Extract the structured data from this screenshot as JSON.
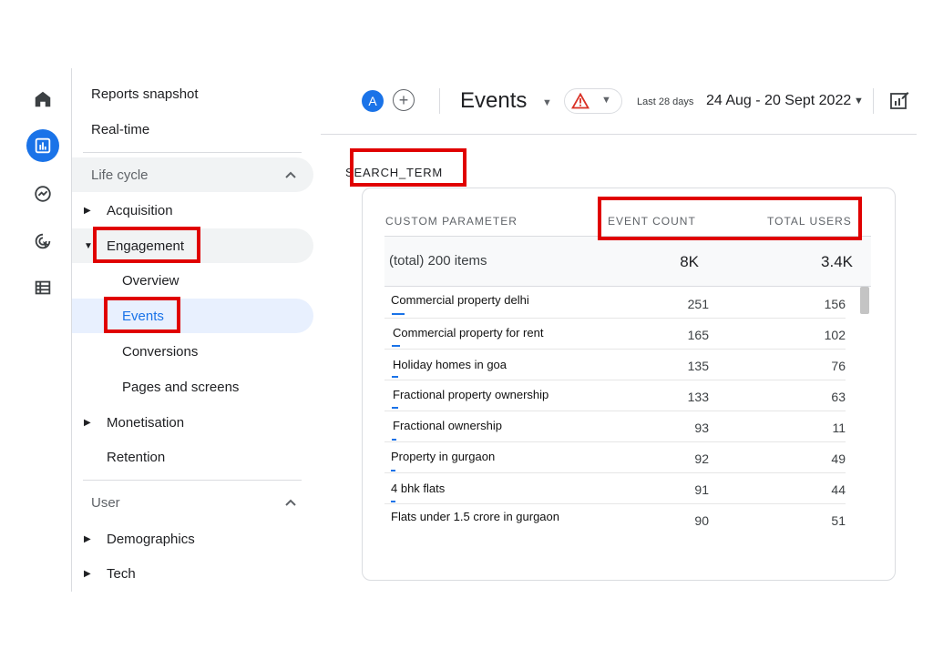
{
  "rail": {
    "items": [
      {
        "icon": "home-icon",
        "active": false
      },
      {
        "icon": "reports-icon",
        "active": true
      },
      {
        "icon": "explore-icon",
        "active": false
      },
      {
        "icon": "advertising-icon",
        "active": false
      },
      {
        "icon": "configure-icon",
        "active": false
      }
    ]
  },
  "nav": {
    "reports_snapshot": "Reports snapshot",
    "real_time": "Real-time",
    "life_cycle": "Life cycle",
    "acquisition": "Acquisition",
    "engagement": "Engagement",
    "overview": "Overview",
    "events": "Events",
    "conversions": "Conversions",
    "pages_and_screens": "Pages and screens",
    "monetisation": "Monetisation",
    "retention": "Retention",
    "user": "User",
    "demographics": "Demographics",
    "tech": "Tech"
  },
  "topbar": {
    "avatar_letter": "A",
    "add_symbol": "+",
    "title": "Events",
    "range_label": "Last 28 days",
    "range_value": "24 Aug - 20 Sept 2022"
  },
  "table": {
    "dimension": "SEARCH_TERM",
    "headers": {
      "parameter": "CUSTOM PARAMETER",
      "event_count": "EVENT COUNT",
      "total_users": "TOTAL USERS"
    },
    "total": {
      "label": "(total) 200 items",
      "event_count": "8K",
      "total_users": "3.4K"
    },
    "rows": [
      {
        "term": "Commercial property delhi",
        "event_count": "251",
        "total_users": "156"
      },
      {
        "term": "Commercial property for rent",
        "event_count": "165",
        "total_users": "102"
      },
      {
        "term": "Holiday homes in goa",
        "event_count": "135",
        "total_users": "76"
      },
      {
        "term": "Fractional property ownership",
        "event_count": "133",
        "total_users": "63"
      },
      {
        "term": "Fractional ownership",
        "event_count": "93",
        "total_users": "11"
      },
      {
        "term": "Property in gurgaon",
        "event_count": "92",
        "total_users": "49"
      },
      {
        "term": "4 bhk flats",
        "event_count": "91",
        "total_users": "44"
      },
      {
        "term": "Flats under 1.5 crore in gurgaon",
        "event_count": "90",
        "total_users": "51"
      }
    ]
  },
  "colors": {
    "accent": "#1a73e8",
    "highlight": "#e00000",
    "warning": "#d93025"
  }
}
